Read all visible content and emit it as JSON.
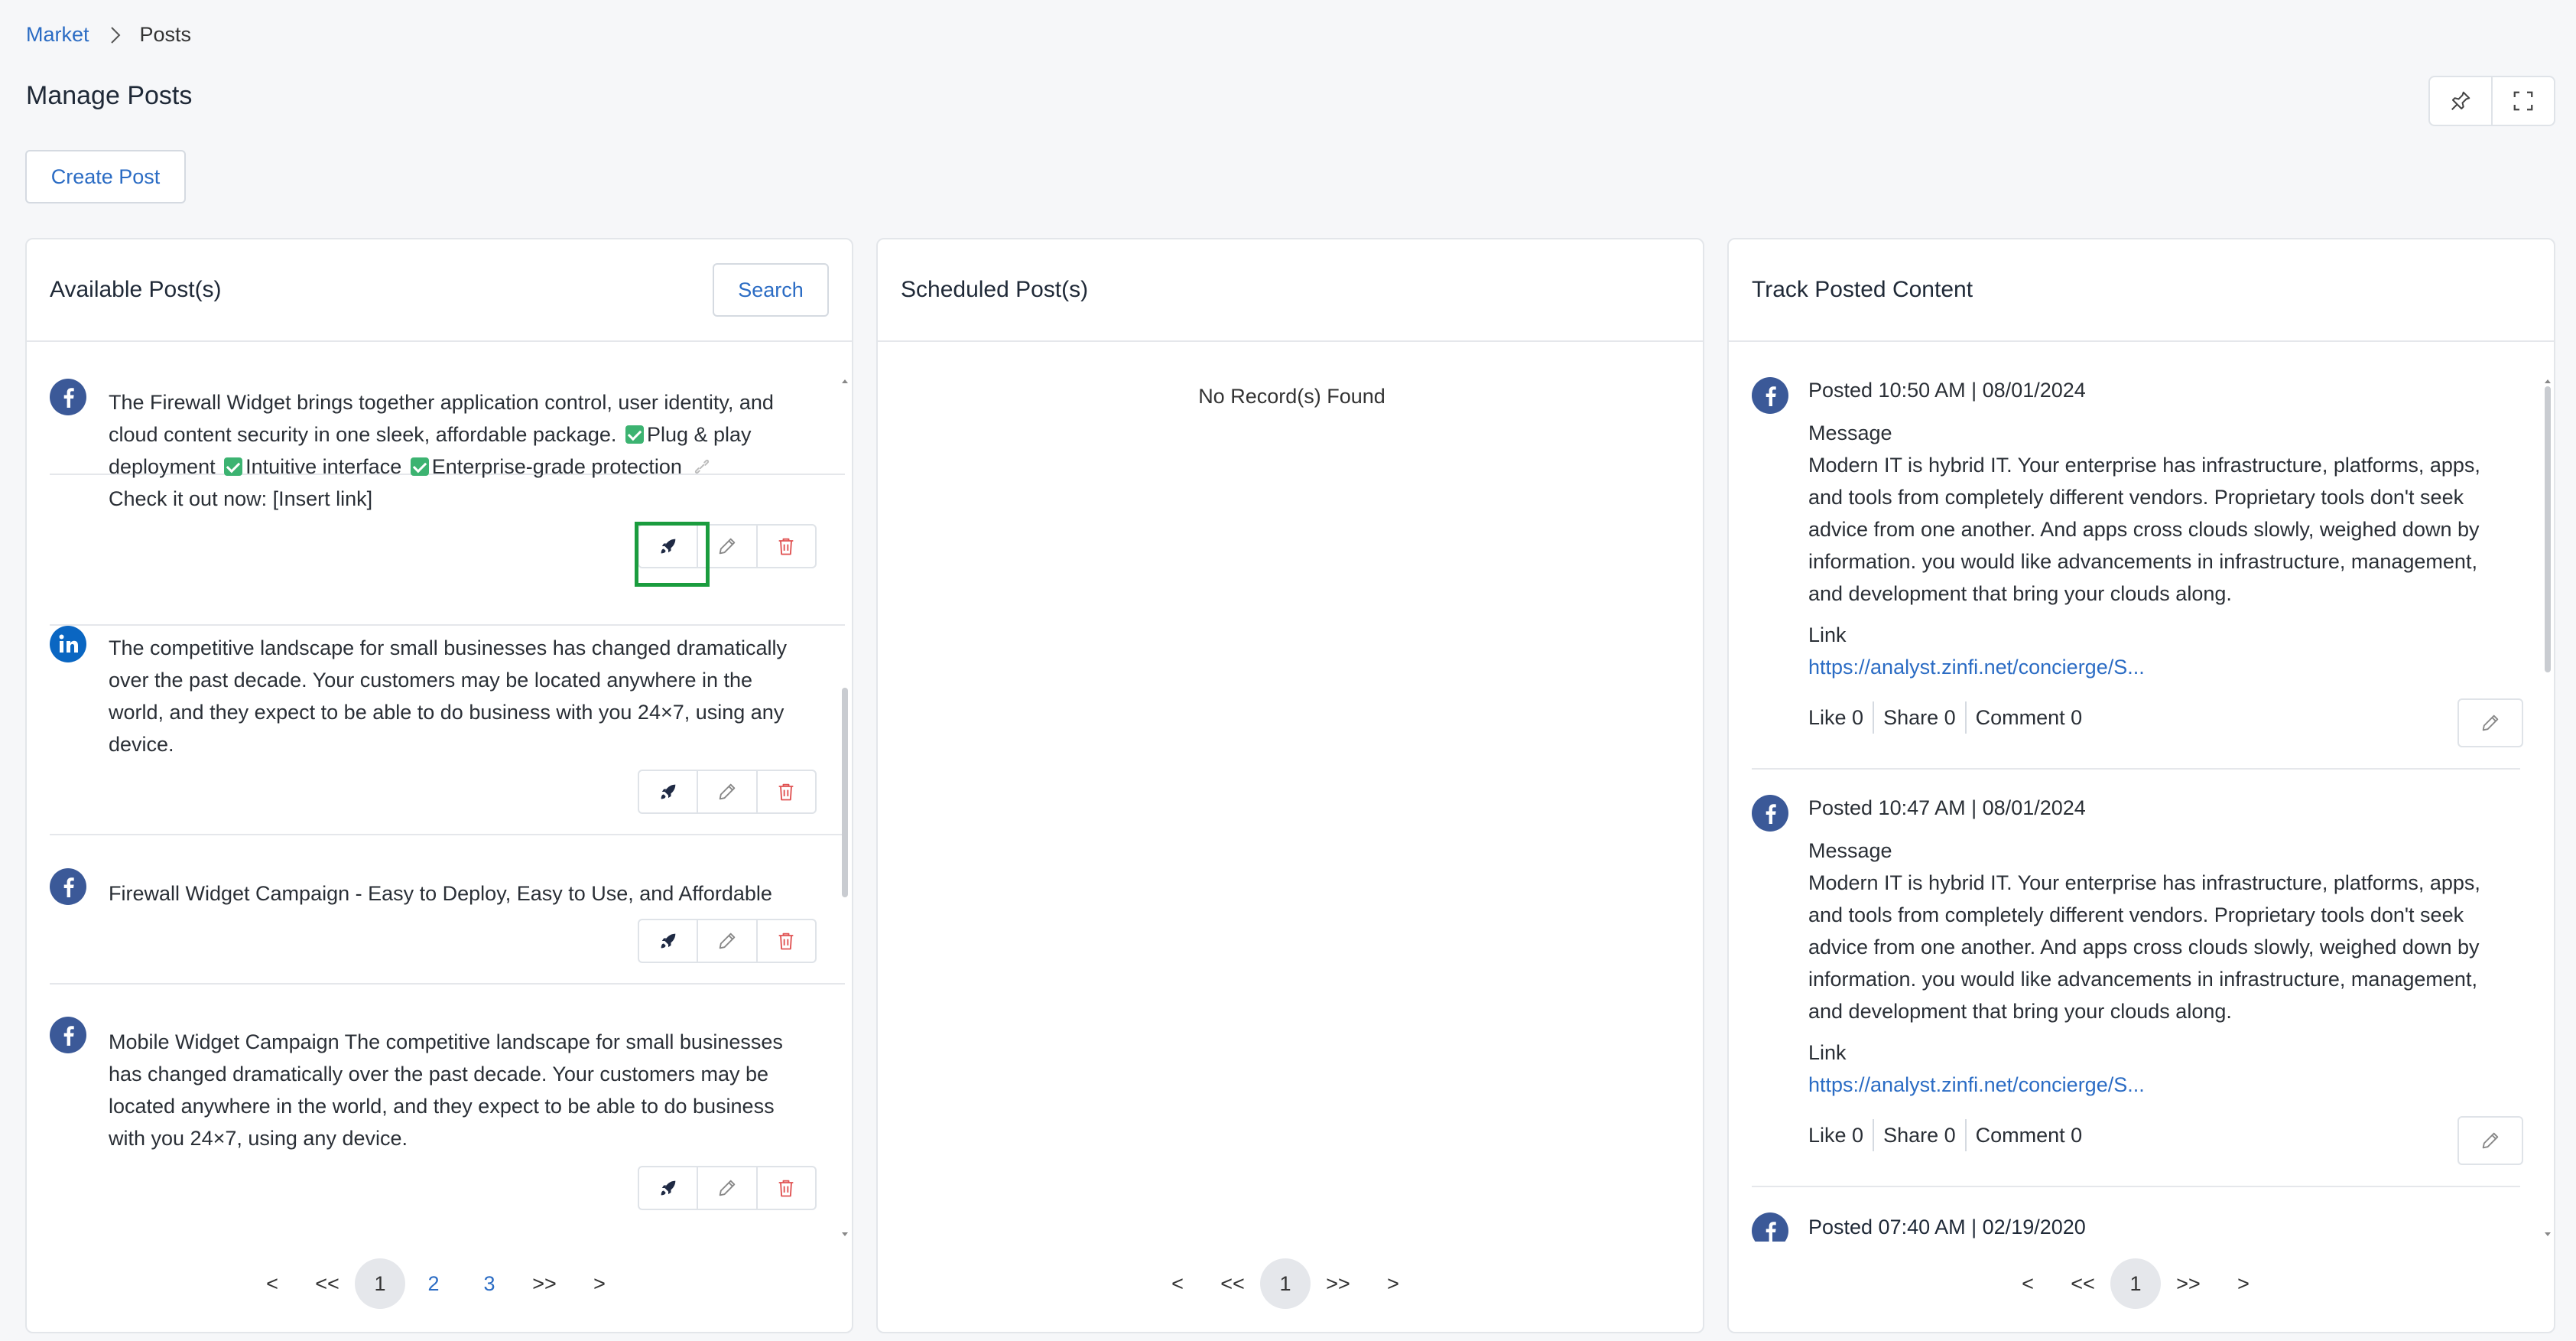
{
  "breadcrumb": {
    "root": "Market",
    "current": "Posts"
  },
  "page_title": "Manage Posts",
  "create_button": "Create Post",
  "panels": {
    "available": {
      "title": "Available Post(s)",
      "search": "Search"
    },
    "scheduled": {
      "title": "Scheduled Post(s)",
      "empty": "No Record(s) Found"
    },
    "tracked": {
      "title": "Track Posted Content"
    }
  },
  "available_posts": [
    {
      "network": "facebook",
      "line1": "The Firewall Widget brings together application control, user identity, and",
      "line2a": "cloud content security in one sleek, affordable package.",
      "line2b": "Plug & play",
      "line3a": "deployment",
      "line3b": "Intuitive interface",
      "line3c": "Enterprise-grade protection",
      "line4": "Check it out now: [Insert link]"
    },
    {
      "network": "linkedin",
      "lines": [
        "The competitive landscape for small businesses has changed dramatically",
        "over the past decade. Your customers may be located anywhere in the",
        "world, and they expect to be able to do business with you 24×7, using any",
        "device."
      ]
    },
    {
      "network": "facebook",
      "lines": [
        "Firewall Widget Campaign - Easy to Deploy, Easy to Use, and Affordable"
      ]
    },
    {
      "network": "facebook",
      "lines": [
        "Mobile Widget Campaign The competitive landscape for small businesses",
        "has changed dramatically over the past decade. Your customers may be",
        "located anywhere in the world, and they expect to be able to do business",
        "with you 24×7, using any device."
      ]
    }
  ],
  "pager_available": {
    "prev": "<",
    "first": "<<",
    "pages": [
      "1",
      "2",
      "3"
    ],
    "last": ">>",
    "next": ">"
  },
  "pager_scheduled": {
    "prev": "<",
    "first": "<<",
    "pages": [
      "1"
    ],
    "last": ">>",
    "next": ">"
  },
  "pager_tracked": {
    "prev": "<",
    "first": "<<",
    "pages": [
      "1"
    ],
    "last": ">>",
    "next": ">"
  },
  "tracked_posts": [
    {
      "posted": "Posted 10:50 AM | 08/01/2024",
      "message_label": "Message",
      "lines": [
        "Modern IT is hybrid IT. Your enterprise has infrastructure, platforms, apps,",
        "and tools from completely different vendors. Proprietary tools don't seek",
        "advice from one another. And apps cross clouds slowly, weighed down by",
        "information. you would like advancements in infrastructure, management,",
        "and development that bring your clouds along."
      ],
      "link_label": "Link",
      "url": "https://analyst.zinfi.net/concierge/S...",
      "like": "Like 0",
      "share": "Share 0",
      "comment": "Comment 0"
    },
    {
      "posted": "Posted 10:47 AM | 08/01/2024",
      "message_label": "Message",
      "lines": [
        "Modern IT is hybrid IT. Your enterprise has infrastructure, platforms, apps,",
        "and tools from completely different vendors. Proprietary tools don't seek",
        "advice from one another. And apps cross clouds slowly, weighed down by",
        "information. you would like advancements in infrastructure, management,",
        "and development that bring your clouds along."
      ],
      "link_label": "Link",
      "url": "https://analyst.zinfi.net/concierge/S...",
      "like": "Like 0",
      "share": "Share 0",
      "comment": "Comment 0"
    },
    {
      "posted": "Posted 07:40 AM | 02/19/2020"
    }
  ],
  "colors": {
    "accent": "#2b6cc4",
    "facebook": "#3b5998",
    "linkedin": "#0a66c2",
    "delete": "#e05252",
    "highlight": "#1a9c3e"
  }
}
